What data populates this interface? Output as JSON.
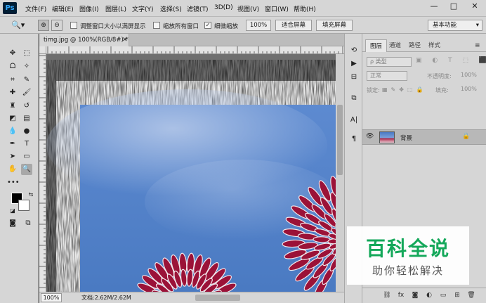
{
  "app": {
    "logo": "Ps"
  },
  "menu": [
    "文件(F)",
    "编辑(E)",
    "图像(I)",
    "图层(L)",
    "文字(Y)",
    "选择(S)",
    "滤镜(T)",
    "3D(D)",
    "视图(V)",
    "窗口(W)",
    "帮助(H)"
  ],
  "window_controls": {
    "minimize": "—",
    "restore": "□",
    "close": "✕"
  },
  "options": {
    "resize_windows_label": "调整窗口大小以满屏显示",
    "zoom_all_label": "缩放所有窗口",
    "scrubby_zoom_label": "细微缩放",
    "scrubby_zoom_checked": "✓",
    "zoom_value": "100%",
    "fit_screen": "适合屏幕",
    "fill_screen": "填充屏幕",
    "workspace": "基本功能"
  },
  "document": {
    "tab_title": "timg.jpg @ 100%(RGB/8#) *",
    "zoom": "100%",
    "doc_size": "文档:2.62M/2.62M"
  },
  "panel": {
    "tabs": [
      "图层",
      "通道",
      "路径",
      "样式"
    ],
    "kind_filter": "ρ 类型",
    "blend_mode": "正常",
    "opacity_label": "不透明度:",
    "opacity_value": "100%",
    "lock_label": "锁定:",
    "fill_label": "填充:",
    "fill_value": "100%",
    "layers": [
      {
        "name": "背景",
        "visible": true,
        "locked": true
      }
    ]
  },
  "watermark": {
    "title": "百科全说",
    "subtitle": "助你轻松解决"
  },
  "colors": {
    "sky_top": "#5b8ad0",
    "sky_bottom": "#4f7fc4",
    "flower_dark": "#9b1238",
    "flower_light": "#f3e6ea",
    "watermark_green": "#14a85a"
  }
}
